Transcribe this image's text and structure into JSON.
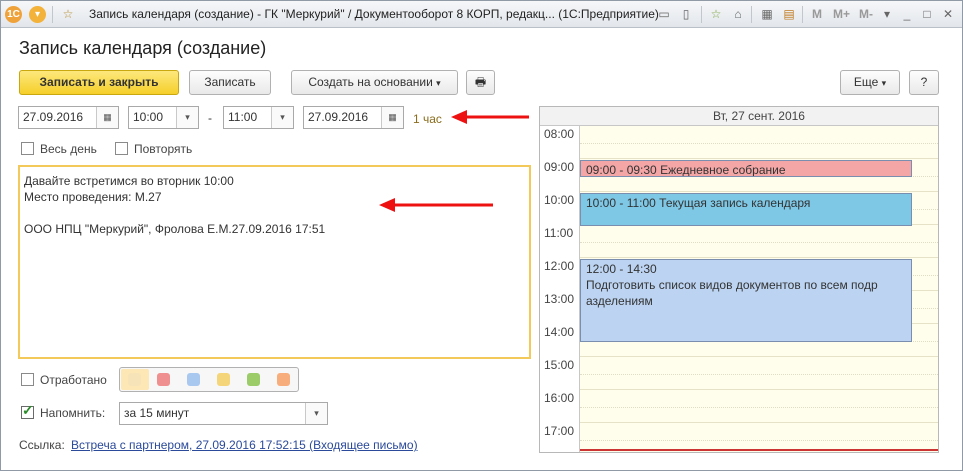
{
  "titlebar": {
    "title": "Запись календаря (создание) - ГК \"Меркурий\" / Документооборот 8 КОРП, редакц...  (1С:Предприятие)",
    "m_labels": [
      "M",
      "M+",
      "M-"
    ]
  },
  "form": {
    "title": "Запись календаря (создание)"
  },
  "toolbar": {
    "save_close": "Записать и закрыть",
    "save": "Записать",
    "create_based": "Создать на основании",
    "more": "Еще",
    "help": "?"
  },
  "dates": {
    "start_date": "27.09.2016",
    "start_time": "10:00",
    "dash": "-",
    "end_time": "11:00",
    "end_date": "27.09.2016",
    "duration": "1 час"
  },
  "options": {
    "all_day": "Весь день",
    "repeat": "Повторять"
  },
  "description": {
    "lines": [
      "Давайте встретимся во вторник 10:00",
      "Место проведения: М.27",
      "",
      "ООО НПЦ \"Меркурий\", Фролова Е.М.27.09.2016 17:51"
    ]
  },
  "status": {
    "done_label": "Отработано",
    "colors": [
      "#f7e3b8",
      "#ef8f8f",
      "#a9c8ef",
      "#f5d57a",
      "#9ccc6a",
      "#f7ad7c"
    ]
  },
  "reminder": {
    "label": "Напомнить:",
    "value": "за 15 минут"
  },
  "link": {
    "label": "Ссылка:",
    "text": "Встреча с партнером, 27.09.2016 17:52:15 (Входящее письмо)"
  },
  "calendar": {
    "header": "Вт, 27 сент. 2016",
    "times": [
      "08:00",
      "09:00",
      "10:00",
      "11:00",
      "12:00",
      "13:00",
      "14:00",
      "15:00",
      "16:00",
      "17:00"
    ],
    "events": [
      {
        "time": "09:00 - 09:30",
        "title": "Ежедневное собрание",
        "color": "#f4a6a6",
        "start": 9.0,
        "end": 9.5
      },
      {
        "time": "10:00 - 11:00",
        "title": "Текущая запись календаря",
        "color": "#7ec8e6",
        "start": 10.0,
        "end": 11.0
      },
      {
        "time": "12:00 - 14:30",
        "title": "Подготовить список видов документов по всем подр азделениям",
        "color": "#bcd4f2",
        "start": 12.0,
        "end": 14.5
      }
    ]
  }
}
